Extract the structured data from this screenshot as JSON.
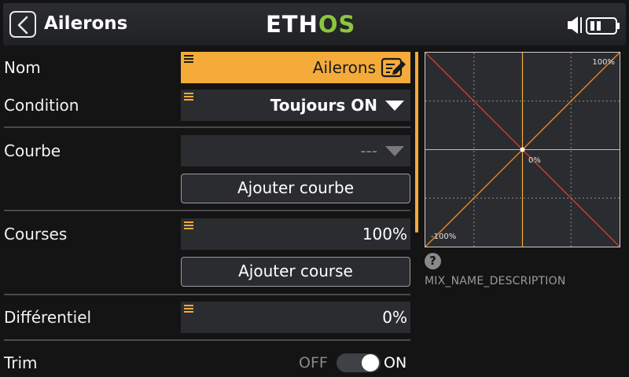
{
  "header": {
    "title": "Ailerons",
    "logo_main": "ETH",
    "logo_accent": "OS"
  },
  "form": {
    "name": {
      "label": "Nom",
      "value": "Ailerons"
    },
    "condition": {
      "label": "Condition",
      "value": "Toujours ON"
    },
    "curve": {
      "label": "Courbe",
      "value": "---",
      "add_label": "Ajouter courbe"
    },
    "rates": {
      "label": "Courses",
      "value": "100%",
      "add_label": "Ajouter course"
    },
    "differential": {
      "label": "Différentiel",
      "value": "0%"
    },
    "trim": {
      "label": "Trim",
      "off_label": "OFF",
      "on_label": "ON",
      "enabled": true
    }
  },
  "graph": {
    "label_max": "100%",
    "label_center": "0%",
    "label_min": "-100%"
  },
  "help": {
    "icon": "?",
    "description": "MIX_NAME_DESCRIPTION"
  },
  "colors": {
    "accent": "#f5ab3a",
    "logo_green": "#8cc63f",
    "curve_orange": "#f0801a",
    "curve_red": "#e04030"
  }
}
